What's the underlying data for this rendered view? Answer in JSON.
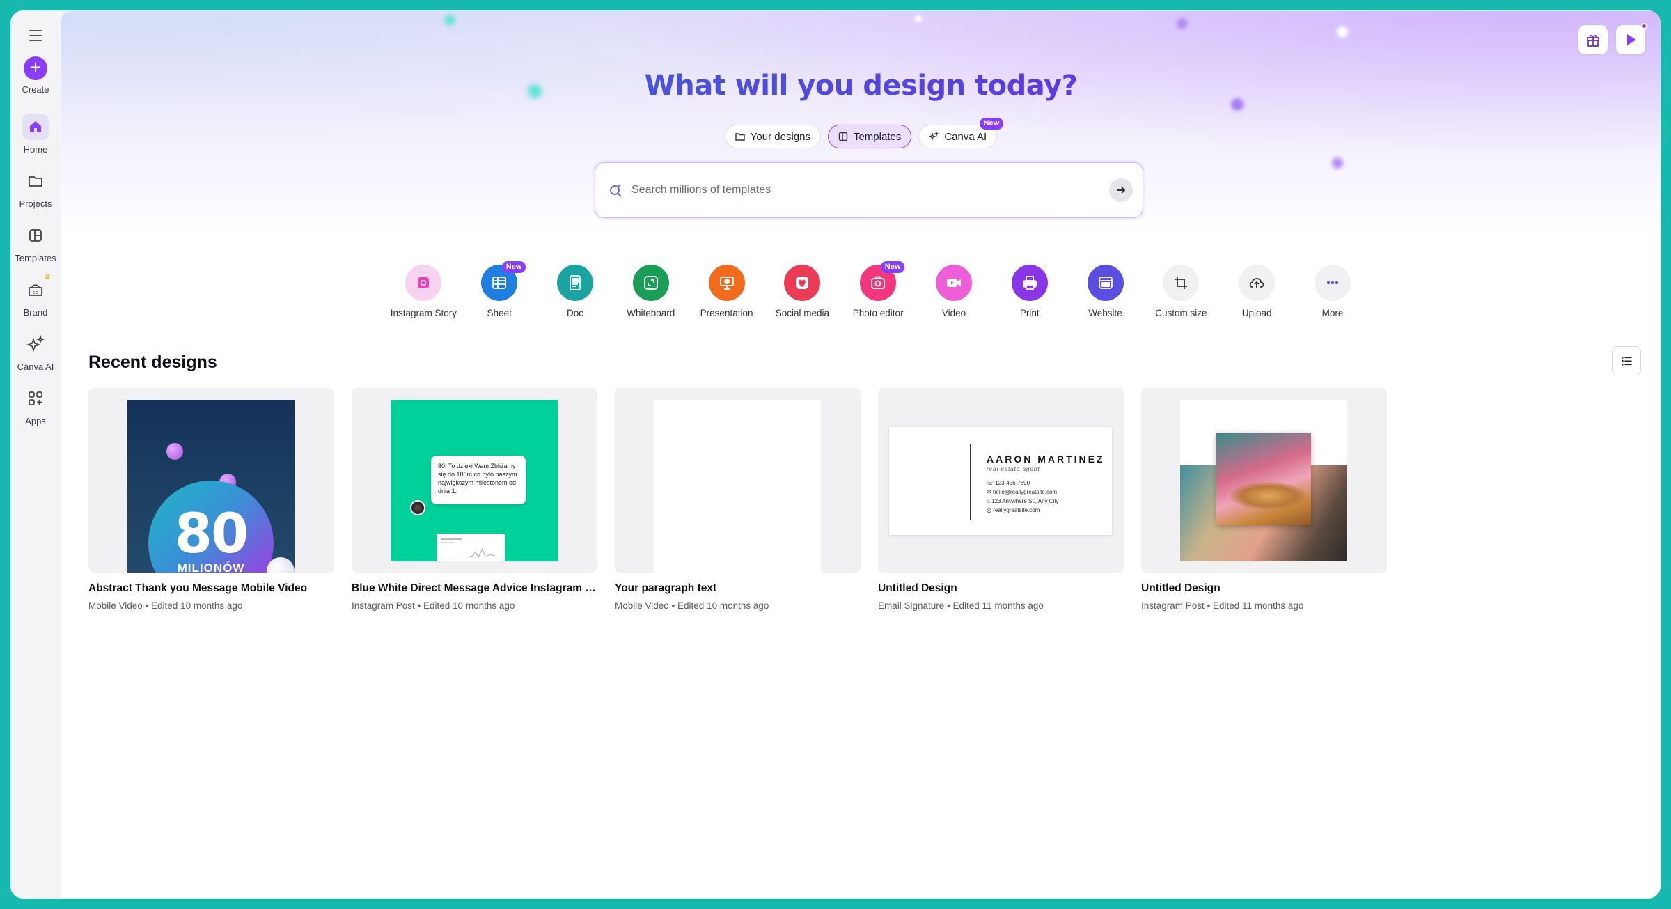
{
  "sidebar": {
    "create_label": "Create",
    "items": [
      {
        "label": "Home"
      },
      {
        "label": "Projects"
      },
      {
        "label": "Templates"
      },
      {
        "label": "Brand"
      },
      {
        "label": "Canva AI"
      },
      {
        "label": "Apps"
      }
    ]
  },
  "hero": {
    "title": "What will you design today?",
    "tabs": [
      {
        "label": "Your designs"
      },
      {
        "label": "Templates"
      },
      {
        "label": "Canva AI",
        "badge": "New"
      }
    ],
    "search_placeholder": "Search millions of templates"
  },
  "shortcuts": [
    {
      "label": "Instagram Story",
      "color": "#f6c7e9",
      "icon": "instagram-story-icon"
    },
    {
      "label": "Sheet",
      "color": "#1e7fe0",
      "icon": "sheet-icon",
      "badge": "New"
    },
    {
      "label": "Doc",
      "color": "#1aa3a0",
      "icon": "doc-icon"
    },
    {
      "label": "Whiteboard",
      "color": "#1a9e57",
      "icon": "whiteboard-icon"
    },
    {
      "label": "Presentation",
      "color": "#f26b1d",
      "icon": "presentation-icon"
    },
    {
      "label": "Social media",
      "color": "#ec3c55",
      "icon": "social-media-icon"
    },
    {
      "label": "Photo editor",
      "color": "#f2377c",
      "icon": "photo-editor-icon",
      "badge": "New"
    },
    {
      "label": "Video",
      "color": "#ee5ed8",
      "icon": "video-icon"
    },
    {
      "label": "Print",
      "color": "#8a35e6",
      "icon": "print-icon"
    },
    {
      "label": "Website",
      "color": "#5a4fe0",
      "icon": "website-icon"
    },
    {
      "label": "Custom size",
      "color": "#f1f1f4",
      "icon": "custom-size-icon"
    },
    {
      "label": "Upload",
      "color": "#f1f1f4",
      "icon": "upload-icon"
    },
    {
      "label": "More",
      "color": "#f1f1f4",
      "icon": "more-icon"
    }
  ],
  "recent": {
    "title": "Recent designs",
    "cards": [
      {
        "title": "Abstract Thank you Message Mobile Video",
        "meta": "Mobile Video • Edited 10 months ago",
        "thumb_number": "80",
        "thumb_sub": "MILIONÓW"
      },
      {
        "title": "Blue White Direct Message Advice Instagram P...",
        "meta": "Instagram Post • Edited 10 months ago",
        "thumb_bubble": "80! To dzięki Wam Zbliżamy się do 100m co było naszym największym milestonem od dnia 1."
      },
      {
        "title": "Your paragraph text",
        "meta": "Mobile Video • Edited 10 months ago"
      },
      {
        "title": "Untitled Design",
        "meta": "Email Signature • Edited 11 months ago",
        "thumb_name": "AARON MARTINEZ",
        "thumb_role": "real estate agent",
        "thumb_rows": [
          "123-456-7890",
          "hello@reallygreatsite.com",
          "123 Anywhere St., Any City",
          "reallygreatsite.com"
        ]
      },
      {
        "title": "Untitled Design",
        "meta": "Instagram Post • Edited 11 months ago"
      }
    ]
  }
}
